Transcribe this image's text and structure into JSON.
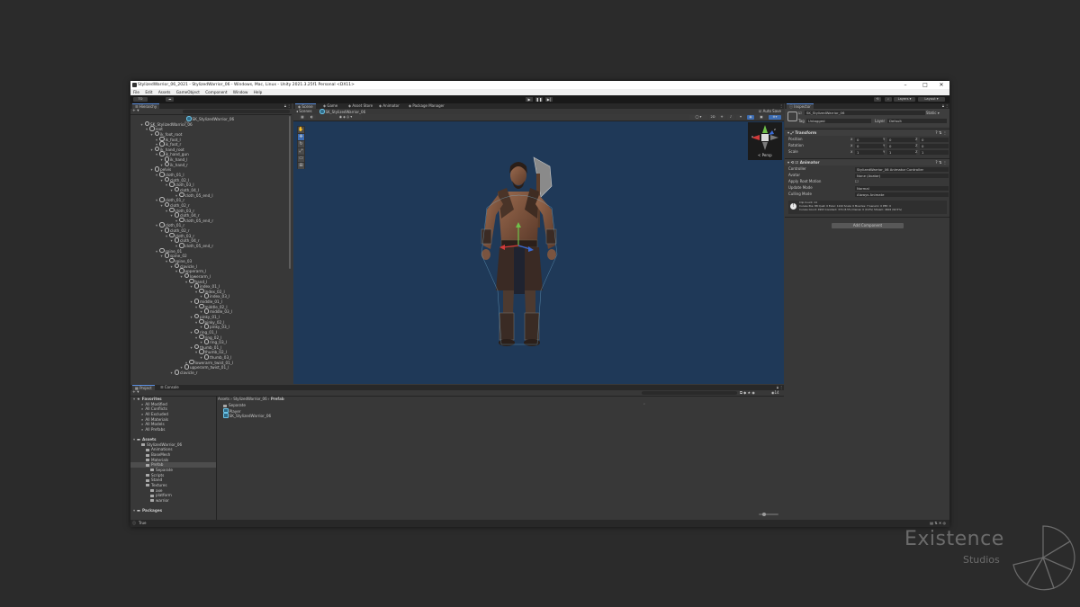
{
  "window": {
    "title": "StylizedWarrior_06_2021 - StylizedWarrior_06 - Windows, Mac, Linux - Unity 2021.3.25f1 Personal <DX11>",
    "controls": [
      "–",
      "□",
      "✕"
    ]
  },
  "menu": [
    "File",
    "Edit",
    "Assets",
    "GameObject",
    "Component",
    "Window",
    "Help"
  ],
  "toolbar": {
    "account_label": "TO",
    "layers_label": "Layers",
    "layout_label": "Layout",
    "play_icon": "play-icon",
    "pause_icon": "pause-icon",
    "step_icon": "step-icon"
  },
  "hierarchy": {
    "tab": "Hierarchy",
    "search_placeholder": "All",
    "scene_name": "SK_StylizedWarrior_06",
    "rows": [
      {
        "d": 1,
        "t": "SK_StylizedWarrior_06"
      },
      {
        "d": 2,
        "t": "root"
      },
      {
        "d": 3,
        "t": "ik_foot_root"
      },
      {
        "d": 4,
        "t": "ik_foot_l"
      },
      {
        "d": 4,
        "t": "ik_foot_r"
      },
      {
        "d": 3,
        "t": "ik_hand_root"
      },
      {
        "d": 4,
        "t": "ik_hand_gun"
      },
      {
        "d": 5,
        "t": "ik_hand_l"
      },
      {
        "d": 5,
        "t": "ik_hand_r"
      },
      {
        "d": 3,
        "t": "pelvis"
      },
      {
        "d": 4,
        "t": "cloth_01_l"
      },
      {
        "d": 5,
        "t": "cloth_02_l"
      },
      {
        "d": 6,
        "t": "cloth_03_l"
      },
      {
        "d": 7,
        "t": "cloth_04_l"
      },
      {
        "d": 8,
        "t": "cloth_05_end_l"
      },
      {
        "d": 4,
        "t": "cloth_01_r"
      },
      {
        "d": 5,
        "t": "cloth_02_r"
      },
      {
        "d": 6,
        "t": "cloth_03_r"
      },
      {
        "d": 7,
        "t": "cloth_04_r"
      },
      {
        "d": 8,
        "t": "cloth_05_end_r"
      },
      {
        "d": 4,
        "t": "cloth_01_r"
      },
      {
        "d": 5,
        "t": "cloth_02_r"
      },
      {
        "d": 6,
        "t": "cloth_03_r"
      },
      {
        "d": 7,
        "t": "cloth_04_r"
      },
      {
        "d": 8,
        "t": "cloth_05_end_r"
      },
      {
        "d": 4,
        "t": "spine_01"
      },
      {
        "d": 5,
        "t": "spine_02"
      },
      {
        "d": 6,
        "t": "spine_03"
      },
      {
        "d": 7,
        "t": "clavicle_l"
      },
      {
        "d": 8,
        "t": "upperarm_l"
      },
      {
        "d": 9,
        "t": "lowerarm_l"
      },
      {
        "d": 10,
        "t": "hand_l"
      },
      {
        "d": 11,
        "t": "index_01_l"
      },
      {
        "d": 12,
        "t": "index_02_l"
      },
      {
        "d": 13,
        "t": "index_03_l"
      },
      {
        "d": 11,
        "t": "middle_01_l"
      },
      {
        "d": 12,
        "t": "middle_02_l"
      },
      {
        "d": 13,
        "t": "middle_03_l"
      },
      {
        "d": 11,
        "t": "pinky_01_l"
      },
      {
        "d": 12,
        "t": "pinky_02_l"
      },
      {
        "d": 13,
        "t": "pinky_03_l"
      },
      {
        "d": 11,
        "t": "ring_01_l"
      },
      {
        "d": 12,
        "t": "ring_02_l"
      },
      {
        "d": 13,
        "t": "ring_03_l"
      },
      {
        "d": 11,
        "t": "thumb_01_l"
      },
      {
        "d": 12,
        "t": "thumb_02_l"
      },
      {
        "d": 13,
        "t": "thumb_03_l"
      },
      {
        "d": 10,
        "t": "lowerarm_twist_01_l"
      },
      {
        "d": 9,
        "t": "upperarm_twist_01_l"
      },
      {
        "d": 7,
        "t": "clavicle_r"
      }
    ]
  },
  "scene_tabs": [
    "Scene",
    "Game",
    "Asset Store",
    "Animator",
    "Package Manager"
  ],
  "scene": {
    "breadcrumb_root": "Scenes",
    "breadcrumb_item": "SK_StylizedWarrior_06",
    "auto_save": "Auto Save",
    "persp_label": "< Persp",
    "gizmo_axis_x": "x",
    "gizmo_axis_z": "z"
  },
  "project": {
    "tabs": [
      "Project",
      "Console"
    ],
    "favorites_header": "Favorites",
    "favorites": [
      "All Modified",
      "All Conflicts",
      "All Excluded",
      "All Materials",
      "All Models",
      "All Prefabs"
    ],
    "assets_header": "Assets",
    "assets_tree": [
      {
        "d": 1,
        "t": "StylizedWarrior_06"
      },
      {
        "d": 2,
        "t": "Animations"
      },
      {
        "d": 2,
        "t": "BaseMesh"
      },
      {
        "d": 2,
        "t": "Materials"
      },
      {
        "d": 2,
        "t": "Prefab"
      },
      {
        "d": 3,
        "t": "Separate"
      },
      {
        "d": 2,
        "t": "Scripts"
      },
      {
        "d": 2,
        "t": "Stand"
      },
      {
        "d": 2,
        "t": "Textures"
      },
      {
        "d": 3,
        "t": "axe"
      },
      {
        "d": 3,
        "t": "platform"
      },
      {
        "d": 3,
        "t": "warrior"
      }
    ],
    "packages_header": "Packages",
    "breadcrumb": [
      "Assets",
      "StylizedWarrior_06",
      "Prefab"
    ],
    "files": [
      {
        "t": "Separate",
        "kind": "folder"
      },
      {
        "t": "Player",
        "kind": "prefab"
      },
      {
        "t": "SK_StylizedWarrior_06",
        "kind": "prefab"
      }
    ],
    "count_badge": "14"
  },
  "inspector": {
    "tab": "Inspector",
    "object_name": "SK_StylizedWarrior_06",
    "static_label": "Static",
    "tag_label": "Tag",
    "tag_value": "Untagged",
    "layer_label": "Layer",
    "layer_value": "Default",
    "transform": {
      "title": "Transform",
      "rows": [
        {
          "label": "Position",
          "x": "0",
          "y": "0",
          "z": "0"
        },
        {
          "label": "Rotation",
          "x": "0",
          "y": "0",
          "z": "0"
        },
        {
          "label": "Scale",
          "x": "1",
          "y": "1",
          "z": "1"
        }
      ]
    },
    "animator": {
      "title": "Animator",
      "rows": [
        {
          "label": "Controller",
          "value": "StylizedWarrior_06 Animator Controller"
        },
        {
          "label": "Avatar",
          "value": "None (Avatar)"
        },
        {
          "label": "Apply Root Motion",
          "value": ""
        },
        {
          "label": "Update Mode",
          "value": "Normal"
        },
        {
          "label": "Culling Mode",
          "value": "Always Animate"
        }
      ],
      "info_lines": [
        "Clip Count: 14",
        "Curves Pos: 88 Quat: 0 Euler: 1242 Scale: 0 Muscles: 7 Generic: 0 PPtr: 0",
        "Curves Count: 4993 Constant: 374 (8.5%) Dense: 0 (0.0%) Stream: 4604 (92.5%)"
      ]
    },
    "add_component": "Add Component"
  },
  "status": {
    "text": "True"
  },
  "watermark": {
    "line1": "Existence",
    "line2": "Studios"
  }
}
